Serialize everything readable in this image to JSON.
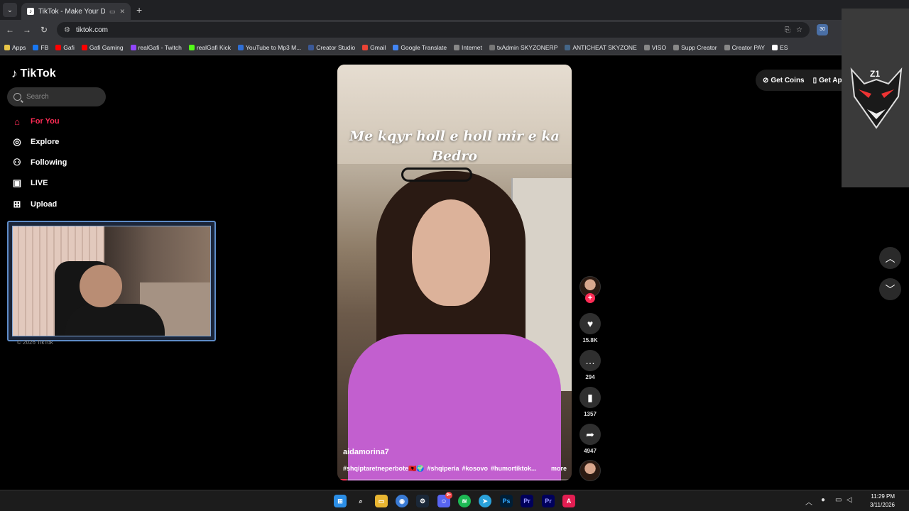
{
  "browser": {
    "tab_title": "TikTok - Make Your Day",
    "url": "tiktok.com",
    "ext_badge": "30",
    "bookmarks": [
      {
        "label": "Apps",
        "color": "#e8c547"
      },
      {
        "label": "FB",
        "color": "#1877f2"
      },
      {
        "label": "Gafi",
        "color": "#ff0000"
      },
      {
        "label": "Gafi Gaming",
        "color": "#ff0000"
      },
      {
        "label": "realGafi - Twitch",
        "color": "#9146ff"
      },
      {
        "label": "realGafi Kick",
        "color": "#53fc18"
      },
      {
        "label": "YouTube to Mp3 M...",
        "color": "#2f6fd6"
      },
      {
        "label": "Creator Studio",
        "color": "#3b5998"
      },
      {
        "label": "Gmail",
        "color": "#ea4335"
      },
      {
        "label": "Google Translate",
        "color": "#4285f4"
      },
      {
        "label": "Internet",
        "color": "#888888"
      },
      {
        "label": "txAdmin SKYZONERP",
        "color": "#777777"
      },
      {
        "label": "ANTICHEAT SKYZONE",
        "color": "#446688"
      },
      {
        "label": "VISO",
        "color": "#888888"
      },
      {
        "label": "Supp Creator",
        "color": "#888888"
      },
      {
        "label": "Creator PAY",
        "color": "#888888"
      },
      {
        "label": "ES",
        "color": "#ffffff"
      }
    ]
  },
  "tiktok": {
    "logo": "TikTok",
    "search_placeholder": "Search",
    "nav": [
      {
        "label": "For You",
        "icon": "home-icon"
      },
      {
        "label": "Explore",
        "icon": "compass-icon"
      },
      {
        "label": "Following",
        "icon": "people-icon"
      },
      {
        "label": "LIVE",
        "icon": "live-icon"
      },
      {
        "label": "Upload",
        "icon": "upload-icon"
      }
    ],
    "copyright": "© 2026 TikTok",
    "get_coins": "Get Coins",
    "get_app": "Get App",
    "video": {
      "caption": "Me kqyr holl e holl mir e ka Bedro",
      "username": "aidamorina7",
      "hashtags": [
        "#shqiptaretneperbote🇦🇱🌍",
        "#shqiperia",
        "#kosovo",
        "#humortiktok..."
      ],
      "more": "more",
      "progress": 0.04
    },
    "actions": {
      "likes": "15.8K",
      "comments": "294",
      "saves": "1357",
      "shares": "4947"
    }
  },
  "overlay": {
    "tag": "Z1"
  },
  "taskbar": {
    "time": "11:29 PM",
    "date": "3/11/2026",
    "discord_badge": "9+"
  }
}
